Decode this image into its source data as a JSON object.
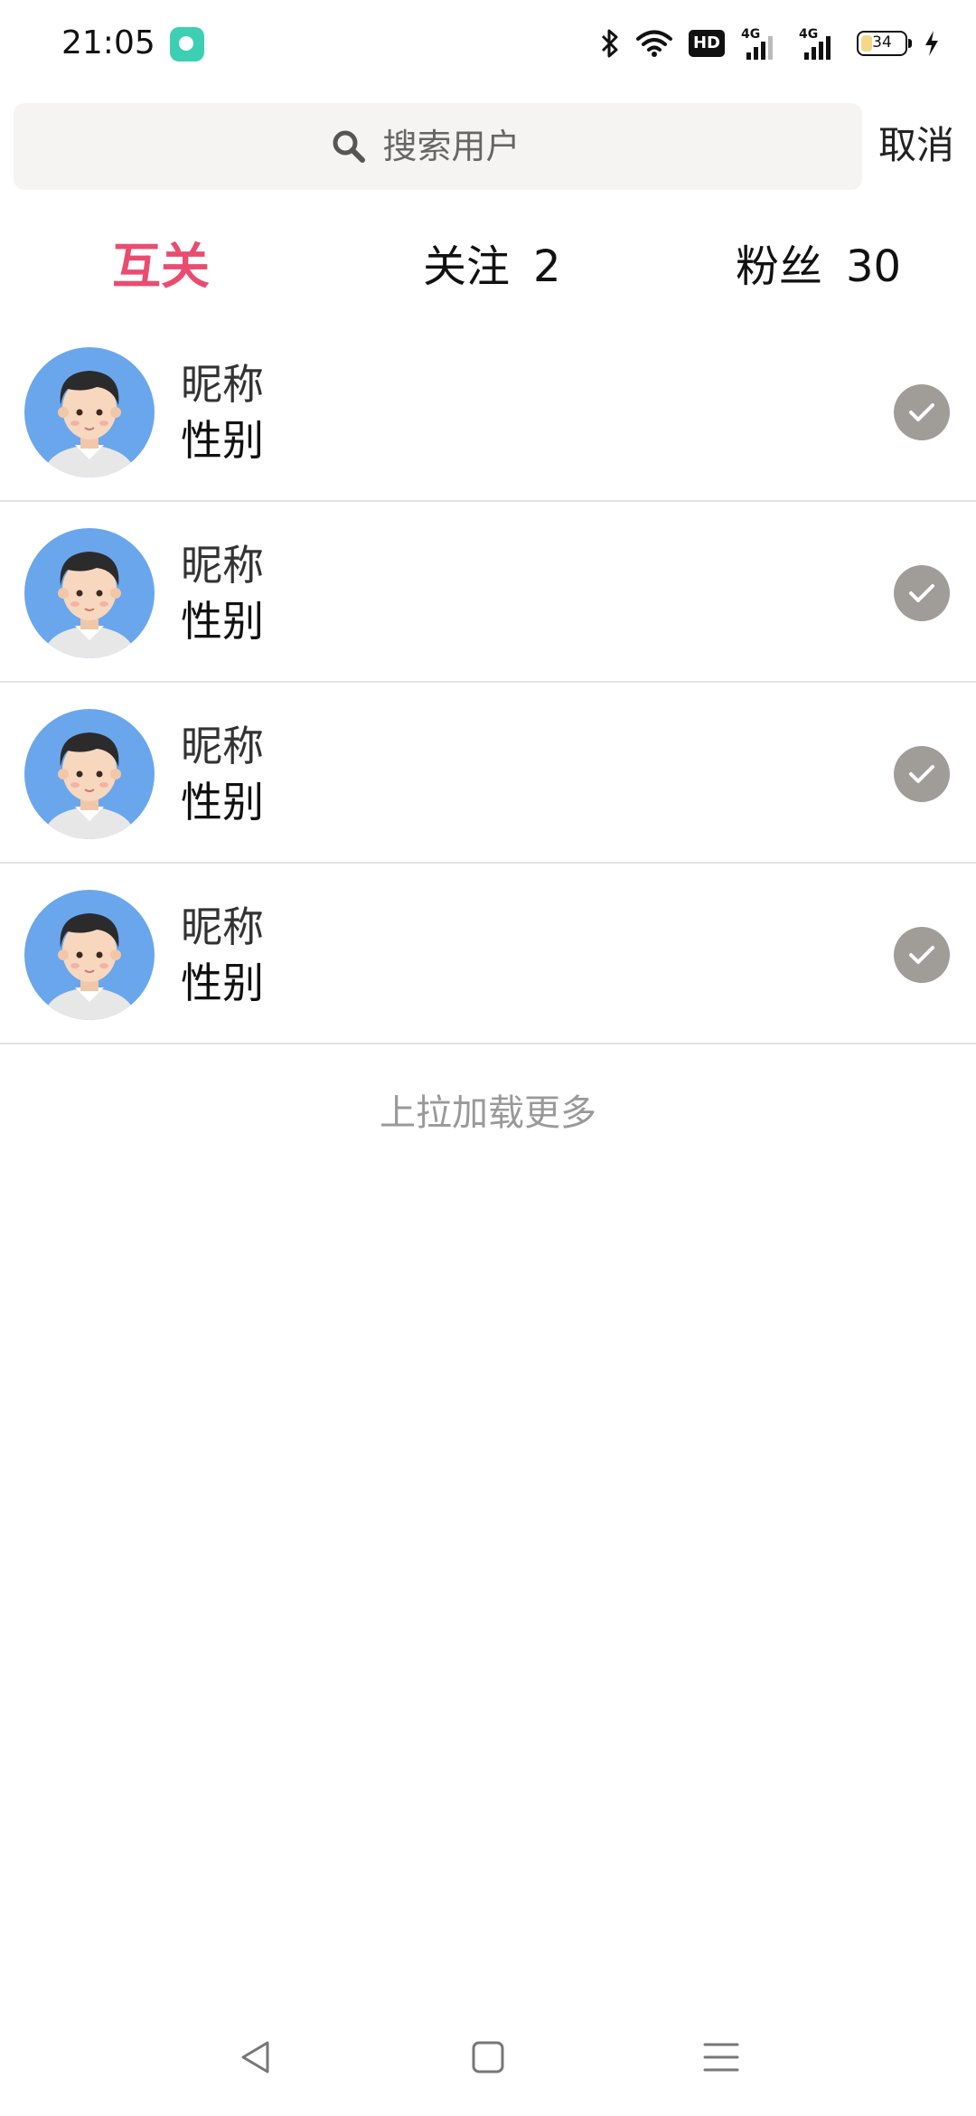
{
  "status_bar": {
    "time": "21:05",
    "hd_label": "HD",
    "network_label_1": "4G",
    "network_label_2": "4G",
    "battery_level": "34",
    "battery_fraction": 0.34
  },
  "search": {
    "placeholder": "搜索用户",
    "value": "",
    "cancel_label": "取消"
  },
  "tabs": [
    {
      "label": "互关",
      "count": "",
      "active": true
    },
    {
      "label": "关注",
      "count": "2",
      "active": false
    },
    {
      "label": "粉丝",
      "count": "30",
      "active": false
    }
  ],
  "users": [
    {
      "nickname": "昵称",
      "gender": "性别",
      "selected": true
    },
    {
      "nickname": "昵称",
      "gender": "性别",
      "selected": true
    },
    {
      "nickname": "昵称",
      "gender": "性别",
      "selected": true
    },
    {
      "nickname": "昵称",
      "gender": "性别",
      "selected": true
    }
  ],
  "load_more_text": "上拉加载更多",
  "colors": {
    "accent": "#e94c6f",
    "check_bg": "#a09c98",
    "search_bg": "#f5f4f2",
    "avatar_bg": "#6aa6ec",
    "app_notification": "#3ccfb4"
  },
  "icons": {
    "search": "search-icon",
    "check": "check-icon",
    "avatar": "avatar-icon",
    "nav_back": "back-triangle-icon",
    "nav_home": "home-square-icon",
    "nav_menu": "menu-lines-icon"
  }
}
